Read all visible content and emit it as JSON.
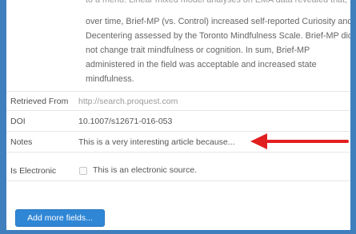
{
  "abstract": {
    "lines": [
      "to a menu. Linear mixed model analyses on EMA data revealed that,",
      "over time, Brief-MP (vs. Control) increased self-reported Curiosity and",
      "Decentering assessed by the Toronto Mindfulness Scale. Brief-MP did",
      "not change trait mindfulness or cognition. In sum, Brief-MP",
      "administered in the field was acceptable and increased state",
      "mindfulness."
    ]
  },
  "fields": {
    "retrieved_from": {
      "label": "Retrieved From",
      "value": "http://search.proquest.com"
    },
    "doi": {
      "label": "DOI",
      "value": "10.1007/s12671-016-053"
    },
    "notes": {
      "label": "Notes",
      "value": "This is a very interesting article because..."
    },
    "is_electronic": {
      "label": "Is Electronic",
      "checkbox_label": "This is an electronic source.",
      "checked": false
    }
  },
  "actions": {
    "add_more_fields": "Add more fields..."
  },
  "annotation": {
    "arrow_color": "#e21f1f"
  },
  "colors": {
    "outer_background": "#3f7fbe",
    "panel_background": "#ffffff",
    "button_background": "#2f86d5"
  }
}
